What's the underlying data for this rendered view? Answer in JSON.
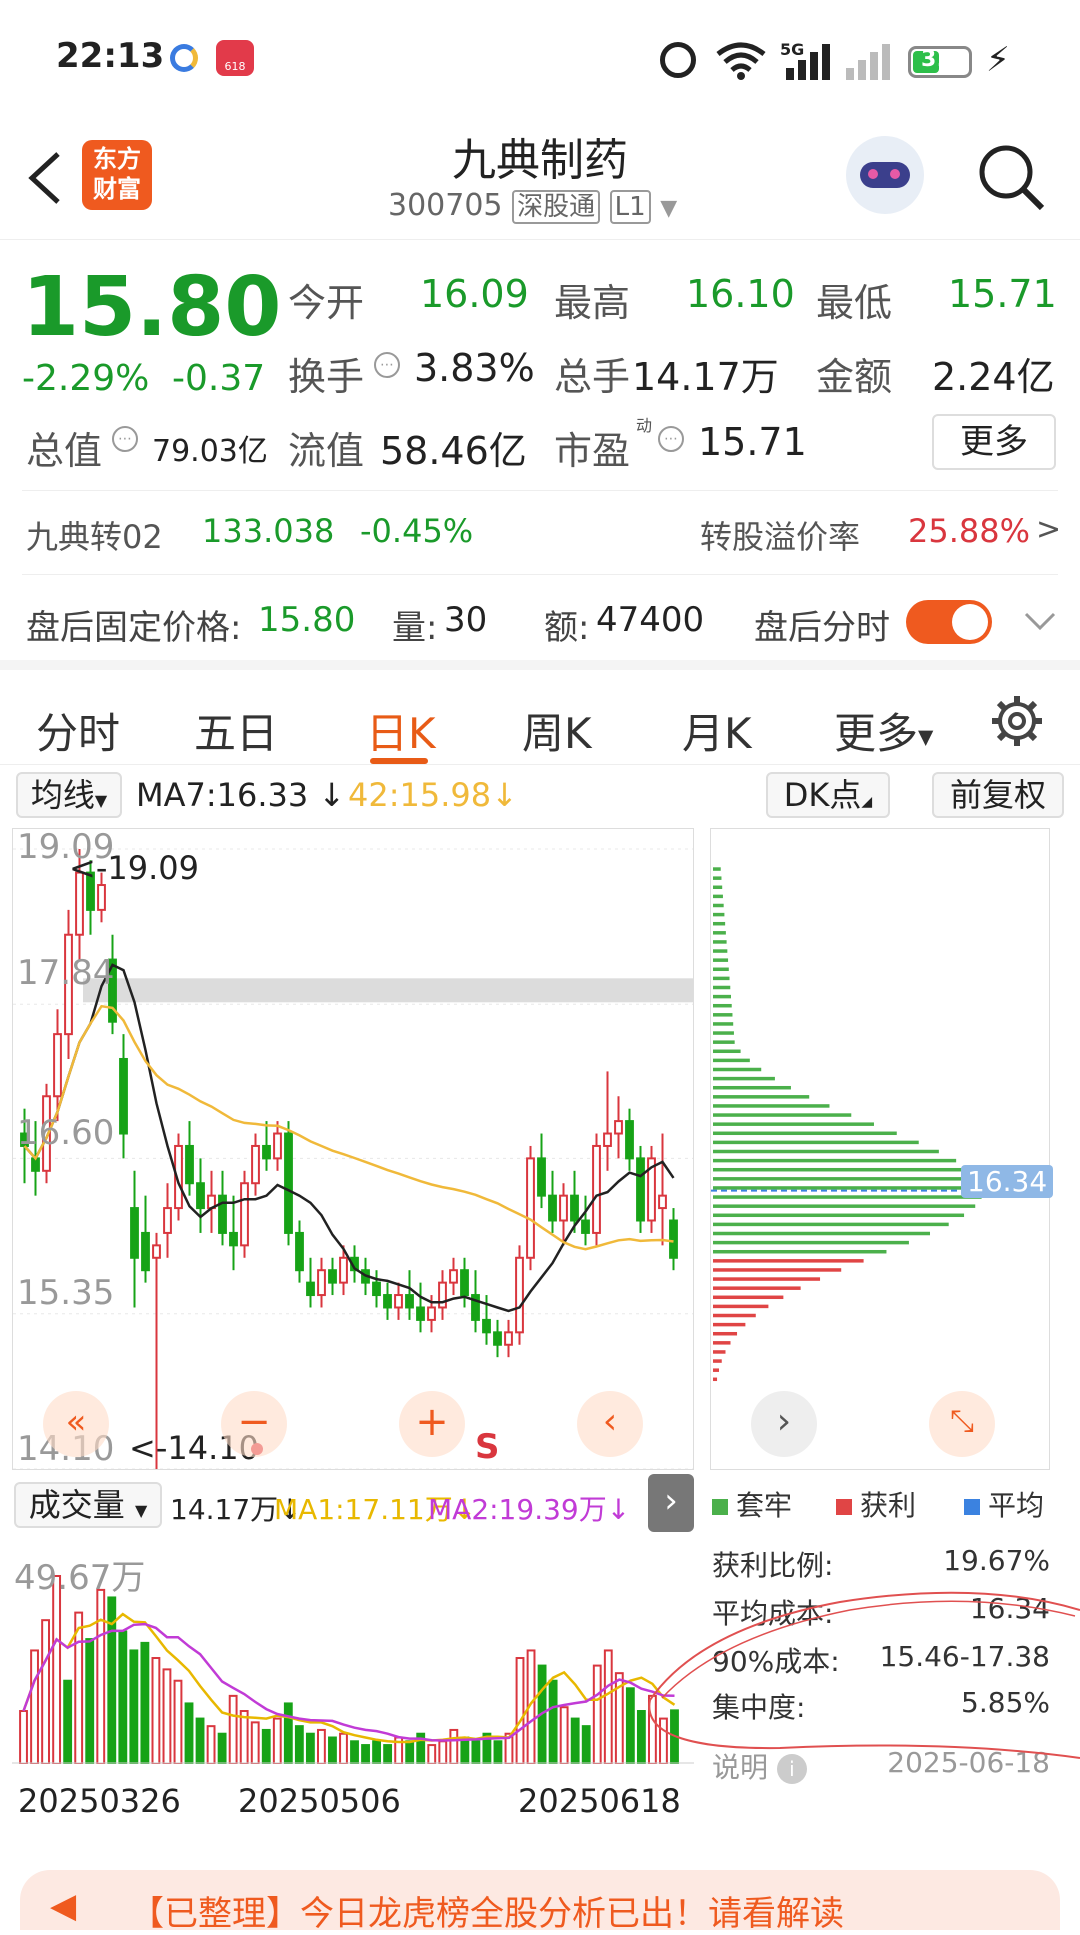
{
  "status_bar": {
    "time": "22:13",
    "badge_618": "618",
    "network": "5G",
    "battery": "31"
  },
  "header": {
    "app_logo": "东方财富",
    "stock_name": "九典制药",
    "stock_code": "300705",
    "tag_market": "深股通",
    "tag_level": "L1"
  },
  "quote": {
    "price": "15.80",
    "change_pct": "-2.29%",
    "change_amt": "-0.37",
    "open_label": "今开",
    "open": "16.09",
    "high_label": "最高",
    "high": "16.10",
    "low_label": "最低",
    "low": "15.71",
    "turnover_label": "换手",
    "turnover": "3.83%",
    "volume_label": "总手",
    "volume": "14.17万",
    "amount_label": "金额",
    "amount": "2.24亿",
    "mktcap_label": "总值",
    "mktcap": "79.03亿",
    "float_label": "流值",
    "float": "58.46亿",
    "pe_label": "市盈",
    "pe_sup": "动",
    "pe": "15.71",
    "more_label": "更多"
  },
  "convertible": {
    "name": "九典转02",
    "price": "133.038",
    "change": "-0.45%",
    "premium_label": "转股溢价率",
    "premium": "25.88%",
    "arrow": ">"
  },
  "after_hours": {
    "price_label": "盘后固定价格:",
    "price": "15.80",
    "vol_label": "量:",
    "vol": "30",
    "amt_label": "额:",
    "amt": "47400",
    "toggle_label": "盘后分时"
  },
  "tabs": [
    "分时",
    "五日",
    "日K",
    "周K",
    "月K",
    "更多"
  ],
  "chart_controls": {
    "ma_select": "均线",
    "ma7": "MA7:16.33",
    "ma42": "42:15.98",
    "dk_btn": "DK点",
    "adjust_btn": "前复权"
  },
  "kline": {
    "ticks": [
      "19.09",
      "17.84",
      "16.60",
      "15.35",
      "14.10"
    ],
    "max_label": "<-19.09",
    "min_label": "<-14.10",
    "signal": "S",
    "colors": {
      "up": "#d9363e",
      "down": "#17a317",
      "ma7": "#222222",
      "ma42": "#f0b93a"
    }
  },
  "volume": {
    "select": "成交量",
    "value": "14.17万",
    "ma1": "MA1:17.11万",
    "ma2": "MA2:19.39万",
    "max_label": "49.67万",
    "dates": [
      "20250326",
      "20250506",
      "20250618"
    ]
  },
  "chip": {
    "avg_price_tag": "16.34",
    "legend_trapped": "套牢",
    "legend_profit": "获利",
    "legend_avg": "平均",
    "profit_ratio_label": "获利比例:",
    "profit_ratio": "19.67%",
    "avg_cost_label": "平均成本:",
    "avg_cost": "16.34",
    "cost90_label": "90%成本:",
    "cost90": "15.46-17.38",
    "concentration_label": "集中度:",
    "concentration": "5.85%",
    "explain_label": "说明",
    "date": "2025-06-18"
  },
  "banner": {
    "text": "【已整理】今日龙虎榜全股分析已出！请看解读"
  },
  "chart_data": [
    {
      "type": "candlestick",
      "title": "",
      "ylim": [
        14.1,
        19.09
      ],
      "yticks": [
        19.09,
        17.84,
        16.6,
        15.35,
        14.1
      ],
      "x_labels": [
        "20250326",
        "20250506",
        "20250618"
      ],
      "series": [
        {
          "name": "MA7",
          "last": 16.33
        },
        {
          "name": "MA42",
          "last": 15.98
        }
      ],
      "candles_ohlc": [
        [
          16.8,
          17.0,
          16.4,
          16.7
        ],
        [
          16.6,
          16.9,
          16.3,
          16.5
        ],
        [
          16.5,
          17.2,
          16.4,
          17.1
        ],
        [
          17.1,
          17.8,
          16.9,
          17.6
        ],
        [
          17.6,
          18.6,
          17.4,
          18.4
        ],
        [
          18.4,
          19.09,
          18.2,
          18.9
        ],
        [
          18.9,
          19.0,
          18.4,
          18.6
        ],
        [
          18.6,
          18.9,
          18.5,
          18.8
        ],
        [
          18.2,
          18.4,
          17.6,
          17.7
        ],
        [
          17.4,
          17.6,
          16.6,
          16.8
        ],
        [
          16.2,
          16.5,
          15.4,
          15.8
        ],
        [
          16.0,
          16.3,
          15.6,
          15.7
        ],
        [
          15.8,
          16.0,
          14.1,
          15.9
        ],
        [
          16.0,
          16.4,
          15.8,
          16.2
        ],
        [
          16.2,
          16.8,
          16.1,
          16.7
        ],
        [
          16.7,
          16.9,
          16.3,
          16.4
        ],
        [
          16.4,
          16.6,
          16.0,
          16.2
        ],
        [
          16.2,
          16.5,
          16.0,
          16.3
        ],
        [
          16.3,
          16.5,
          15.9,
          16.0
        ],
        [
          16.0,
          16.3,
          15.7,
          15.9
        ],
        [
          15.9,
          16.5,
          15.8,
          16.4
        ],
        [
          16.4,
          16.8,
          16.3,
          16.7
        ],
        [
          16.7,
          16.9,
          16.5,
          16.6
        ],
        [
          16.6,
          16.9,
          16.5,
          16.8
        ],
        [
          16.8,
          16.9,
          15.9,
          16.0
        ],
        [
          16.0,
          16.1,
          15.6,
          15.7
        ],
        [
          15.6,
          15.8,
          15.4,
          15.5
        ],
        [
          15.5,
          15.8,
          15.4,
          15.7
        ],
        [
          15.7,
          15.8,
          15.5,
          15.6
        ],
        [
          15.6,
          15.9,
          15.5,
          15.8
        ],
        [
          15.8,
          15.9,
          15.6,
          15.7
        ],
        [
          15.7,
          15.8,
          15.5,
          15.6
        ],
        [
          15.6,
          15.7,
          15.4,
          15.5
        ],
        [
          15.5,
          15.6,
          15.3,
          15.4
        ],
        [
          15.4,
          15.6,
          15.3,
          15.5
        ],
        [
          15.5,
          15.7,
          15.3,
          15.4
        ],
        [
          15.4,
          15.6,
          15.2,
          15.3
        ],
        [
          15.3,
          15.5,
          15.2,
          15.4
        ],
        [
          15.4,
          15.7,
          15.3,
          15.6
        ],
        [
          15.6,
          15.8,
          15.5,
          15.7
        ],
        [
          15.7,
          15.8,
          15.4,
          15.5
        ],
        [
          15.5,
          15.7,
          15.2,
          15.3
        ],
        [
          15.3,
          15.5,
          15.1,
          15.2
        ],
        [
          15.2,
          15.3,
          15.0,
          15.1
        ],
        [
          15.1,
          15.3,
          15.0,
          15.2
        ],
        [
          15.2,
          15.9,
          15.1,
          15.8
        ],
        [
          15.8,
          16.7,
          15.7,
          16.6
        ],
        [
          16.6,
          16.8,
          16.2,
          16.3
        ],
        [
          16.3,
          16.5,
          16.0,
          16.1
        ],
        [
          16.1,
          16.4,
          15.9,
          16.3
        ],
        [
          16.3,
          16.5,
          16.0,
          16.1
        ],
        [
          16.1,
          16.3,
          15.9,
          16.0
        ],
        [
          16.0,
          16.8,
          15.9,
          16.7
        ],
        [
          16.7,
          17.3,
          16.5,
          16.8
        ],
        [
          16.8,
          17.1,
          16.6,
          16.9
        ],
        [
          16.9,
          17.0,
          16.5,
          16.6
        ],
        [
          16.6,
          16.7,
          16.0,
          16.1
        ],
        [
          16.1,
          16.7,
          16.0,
          16.6
        ],
        [
          16.2,
          16.8,
          15.9,
          16.3
        ],
        [
          16.1,
          16.2,
          15.7,
          15.8
        ]
      ]
    },
    {
      "type": "bar",
      "title": "",
      "ylim": [
        0,
        49.67
      ],
      "unit": "万",
      "series": [
        {
          "name": "MA1",
          "last": 17.11
        },
        {
          "name": "MA2",
          "last": 19.39
        }
      ],
      "values": [
        14,
        30,
        38,
        49.67,
        22,
        40,
        33,
        46,
        44,
        35,
        30,
        32,
        28,
        25,
        22,
        16,
        12,
        10,
        8,
        18,
        14,
        11,
        9,
        12,
        16,
        10,
        8,
        9,
        7,
        8,
        6,
        5,
        6,
        5,
        7,
        6,
        8,
        5,
        6,
        9,
        7,
        6,
        8,
        6,
        8,
        28,
        30,
        26,
        22,
        15,
        12,
        10,
        26,
        30,
        24,
        20,
        14,
        18,
        12,
        14.17
      ],
      "up": [
        true,
        true,
        true,
        true,
        false,
        true,
        false,
        true,
        false,
        false,
        false,
        false,
        true,
        true,
        true,
        false,
        false,
        true,
        false,
        true,
        true,
        true,
        false,
        true,
        false,
        false,
        false,
        true,
        false,
        true,
        false,
        false,
        false,
        false,
        true,
        false,
        false,
        true,
        true,
        true,
        false,
        false,
        false,
        false,
        true,
        true,
        true,
        false,
        false,
        true,
        false,
        false,
        true,
        true,
        true,
        false,
        false,
        true,
        true,
        false
      ]
    },
    {
      "type": "bar",
      "title": "",
      "orientation": "horizontal",
      "avg_cost": 16.34,
      "profit_ratio": 19.67,
      "concentration": 5.85
    }
  ]
}
